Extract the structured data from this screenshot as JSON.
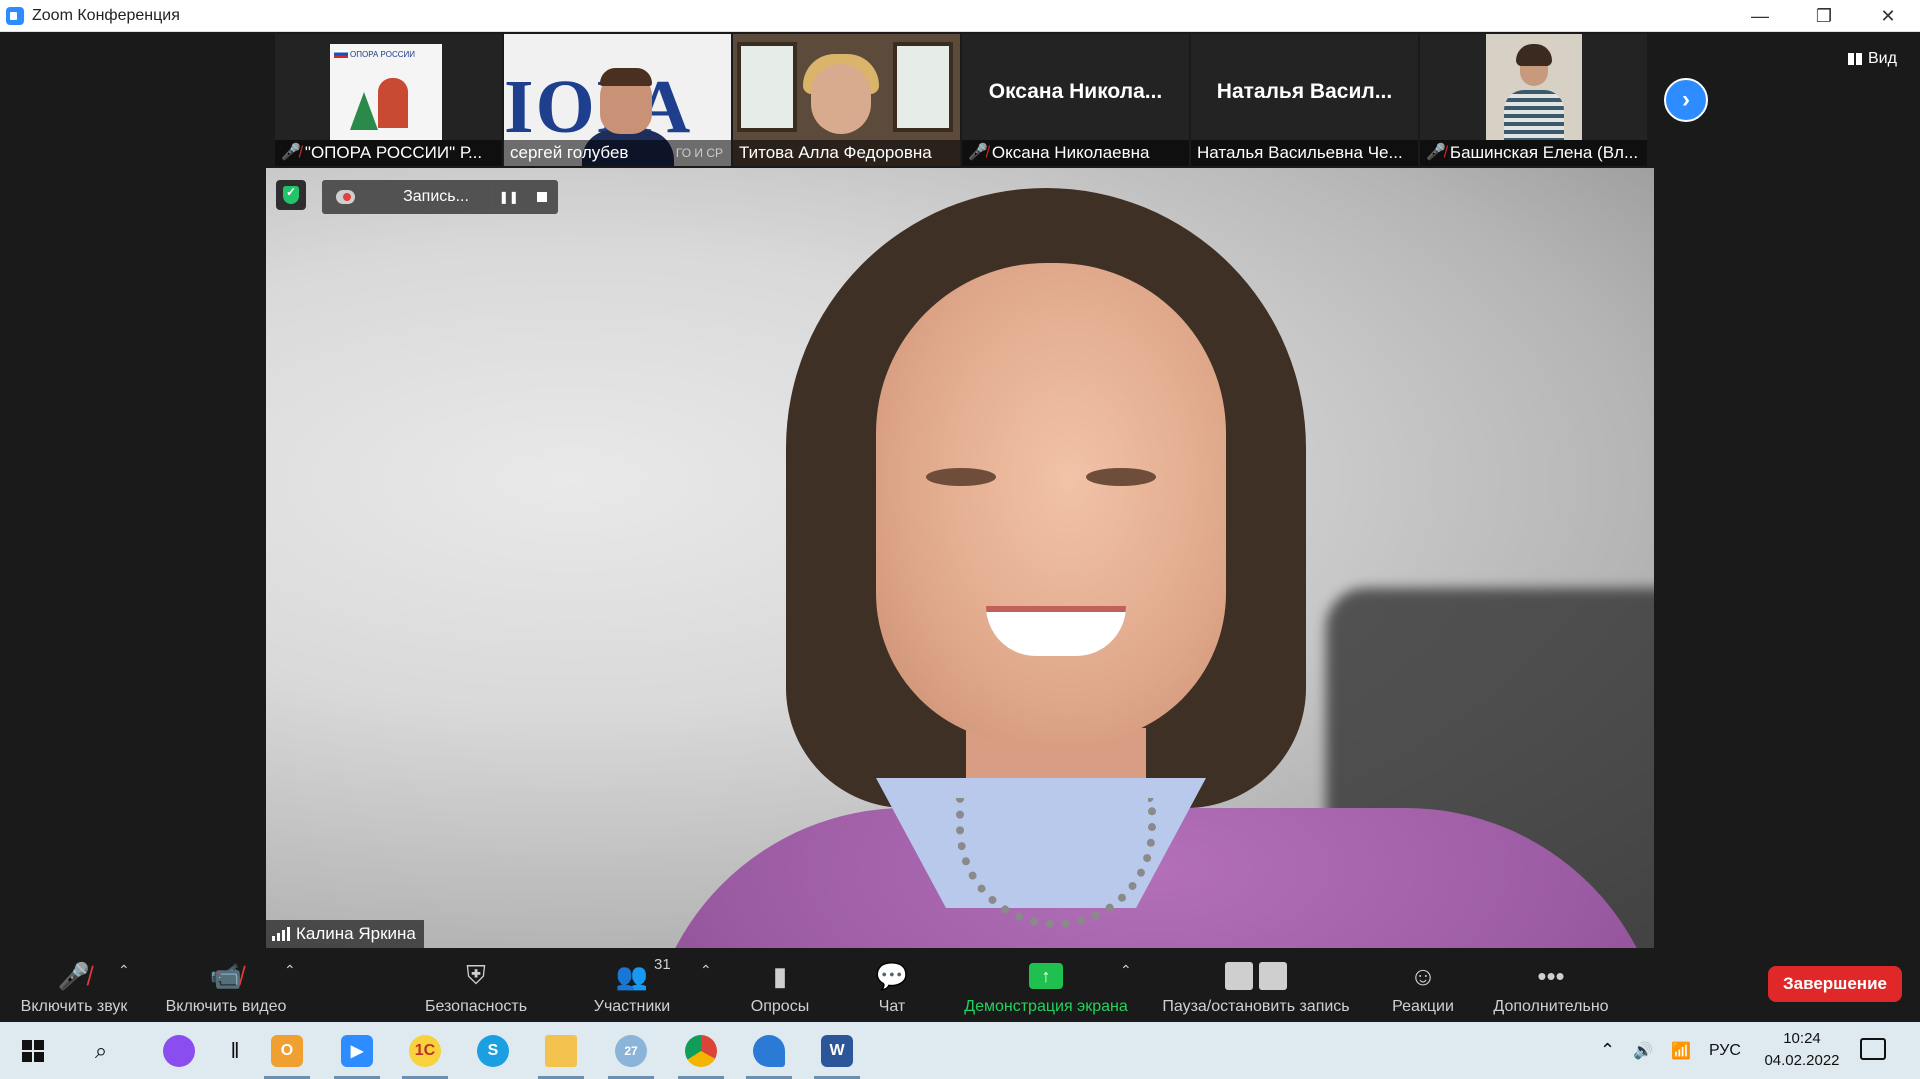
{
  "window": {
    "title": "Zoom Конференция",
    "controls": [
      "—",
      "❐",
      "✕"
    ]
  },
  "thumbnails": [
    {
      "name": "\"ОПОРА РОССИИ\" Р...",
      "muted": true,
      "logo_text": "ОПОРА РОССИИ"
    },
    {
      "name": "сергей голубев",
      "muted": false,
      "bg_text": "ІОРА РО",
      "bg_small": "ГО И СР"
    },
    {
      "name": "Титова Алла Федоровна",
      "muted": false
    },
    {
      "name": "Оксана Николаевна",
      "big_name": "Оксана Никола...",
      "muted": true
    },
    {
      "name": "Наталья Васильевна Че...",
      "big_name": "Наталья Васил...",
      "muted": false
    },
    {
      "name": "Башинская Елена (Вл...",
      "muted": true
    }
  ],
  "view_button": "Вид",
  "recording": {
    "label": "Запись...",
    "pause_icon": "pause-icon",
    "stop_icon": "stop-icon"
  },
  "speaker": {
    "name": "Калина Яркина"
  },
  "toolbar": {
    "unmute": "Включить звук",
    "start_video": "Включить видео",
    "security": "Безопасность",
    "participants": "Участники",
    "participants_count": "31",
    "polls": "Опросы",
    "chat": "Чат",
    "share_screen": "Демонстрация экрана",
    "pause_stop_recording": "Пауза/остановить запись",
    "reactions": "Реакции",
    "more": "Дополнительно",
    "end": "Завершение"
  },
  "taskbar": {
    "apps": [
      "windows-start-icon",
      "search-icon",
      "alice-icon",
      "task-view-icon",
      "outlook-icon",
      "zoom-icon",
      "1c-icon",
      "skype-icon",
      "file-explorer-icon",
      "weather-icon",
      "chrome-icon",
      "edge-icon",
      "word-icon"
    ],
    "weather_badge": "27",
    "language": "РУС",
    "time": "10:24",
    "date": "04.02.2022"
  },
  "colors": {
    "zoom_blue": "#2d8cff",
    "end_red": "#e02828",
    "share_green": "#1fc04f",
    "muted_red": "#e02828"
  }
}
